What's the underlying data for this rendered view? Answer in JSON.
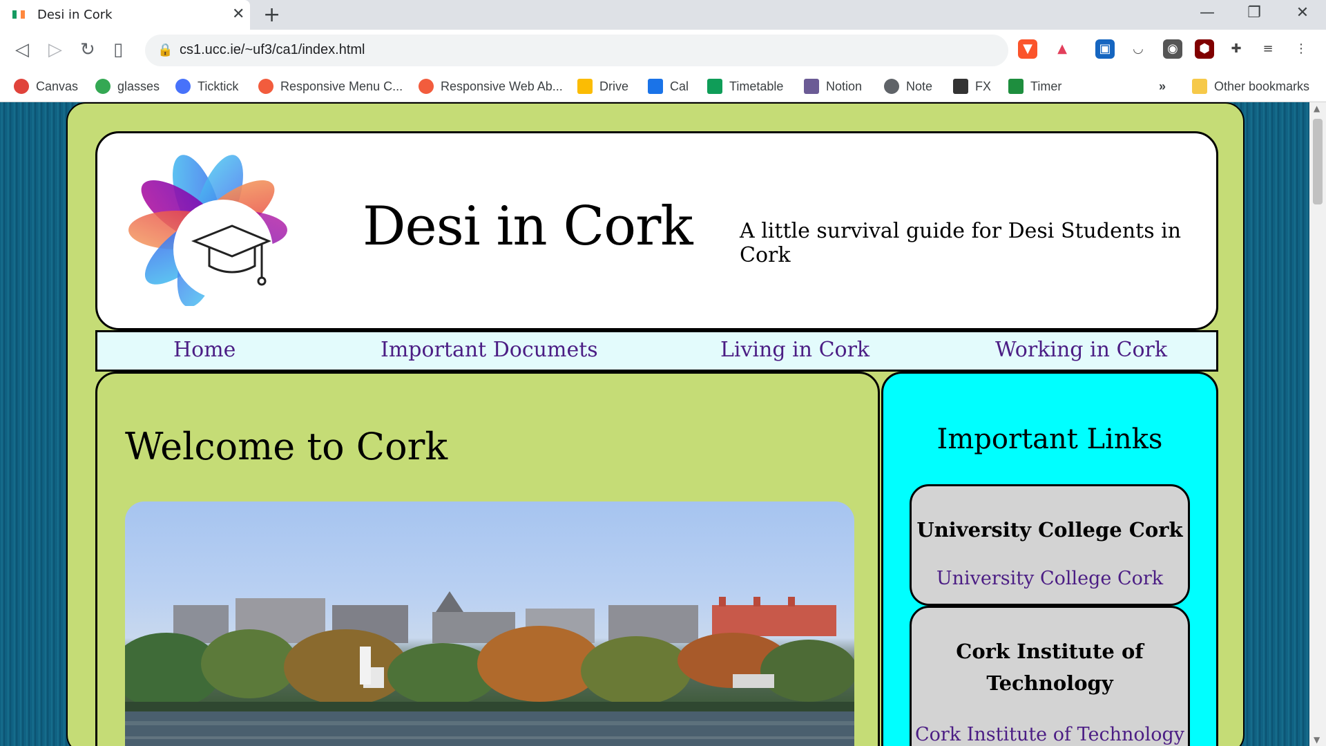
{
  "browser": {
    "tab_title": "Desi in Cork",
    "url": "cs1.ucc.ie/~uf3/ca1/index.html",
    "bookmarks": [
      {
        "label": "Canvas",
        "color": "#e0433b"
      },
      {
        "label": "glasses",
        "color": "#34a853"
      },
      {
        "label": "Ticktick",
        "color": "#4772fa"
      },
      {
        "label": "Responsive Menu C...",
        "color": "#f25c3d"
      },
      {
        "label": "Responsive Web Ab...",
        "color": "#f25c3d"
      },
      {
        "label": "Drive",
        "color": "#fbbc04"
      },
      {
        "label": "Cal",
        "color": "#1a73e8"
      },
      {
        "label": "Timetable",
        "color": "#0f9d58"
      },
      {
        "label": "Notion",
        "color": "#6b5b95"
      },
      {
        "label": "Note",
        "color": "#5f6368"
      },
      {
        "label": "FX",
        "color": "#333333"
      },
      {
        "label": "Timer",
        "color": "#1e8e3e"
      }
    ],
    "other_bookmarks": "Other bookmarks",
    "overflow": "»"
  },
  "site": {
    "title": "Desi in Cork",
    "tagline": "A little survival guide for Desi Students in Cork",
    "nav": [
      "Home",
      "Important Documets",
      "Living in Cork",
      "Working in Cork"
    ],
    "main_heading": "Welcome to Cork",
    "sidebar": {
      "heading": "Important Links",
      "cards": [
        {
          "name": "University College Cork",
          "link": "University College Cork"
        },
        {
          "name": "Cork Institute of Technology",
          "link": "Cork Institute of Technology"
        }
      ]
    }
  },
  "colors": {
    "page_green": "#c5dc76",
    "nav_link": "#4b1d84",
    "sidebar_cyan": "#00ffff"
  }
}
